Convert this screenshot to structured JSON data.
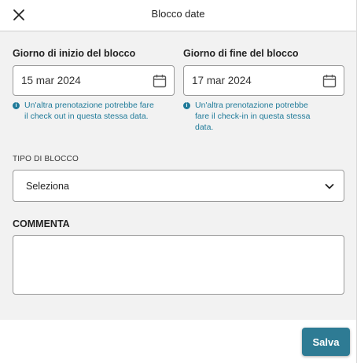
{
  "header": {
    "title": "Blocco date",
    "close_icon": "close-icon"
  },
  "start": {
    "label": "Giorno di inizio del blocco",
    "value": "15 mar 2024",
    "hint_line1": "Un'altra prenotazione potrebbe fare",
    "hint_line2": "il check out in questa stessa data."
  },
  "end": {
    "label": "Giorno di fine del blocco",
    "value": "17 mar 2024",
    "hint_line1": "Un'altra prenotazione potrebbe",
    "hint_line2": "fare il check-in in questa stessa",
    "hint_line3": "data."
  },
  "block_type": {
    "label": "TIPO DI BLOCCO",
    "selected": "Seleziona"
  },
  "comment": {
    "label": "COMMENTA",
    "value": ""
  },
  "footer": {
    "save_label": "Salva"
  },
  "colors": {
    "accent": "#2e7b94",
    "hint": "#1f7a99",
    "body_bg": "#f2f2f2"
  }
}
